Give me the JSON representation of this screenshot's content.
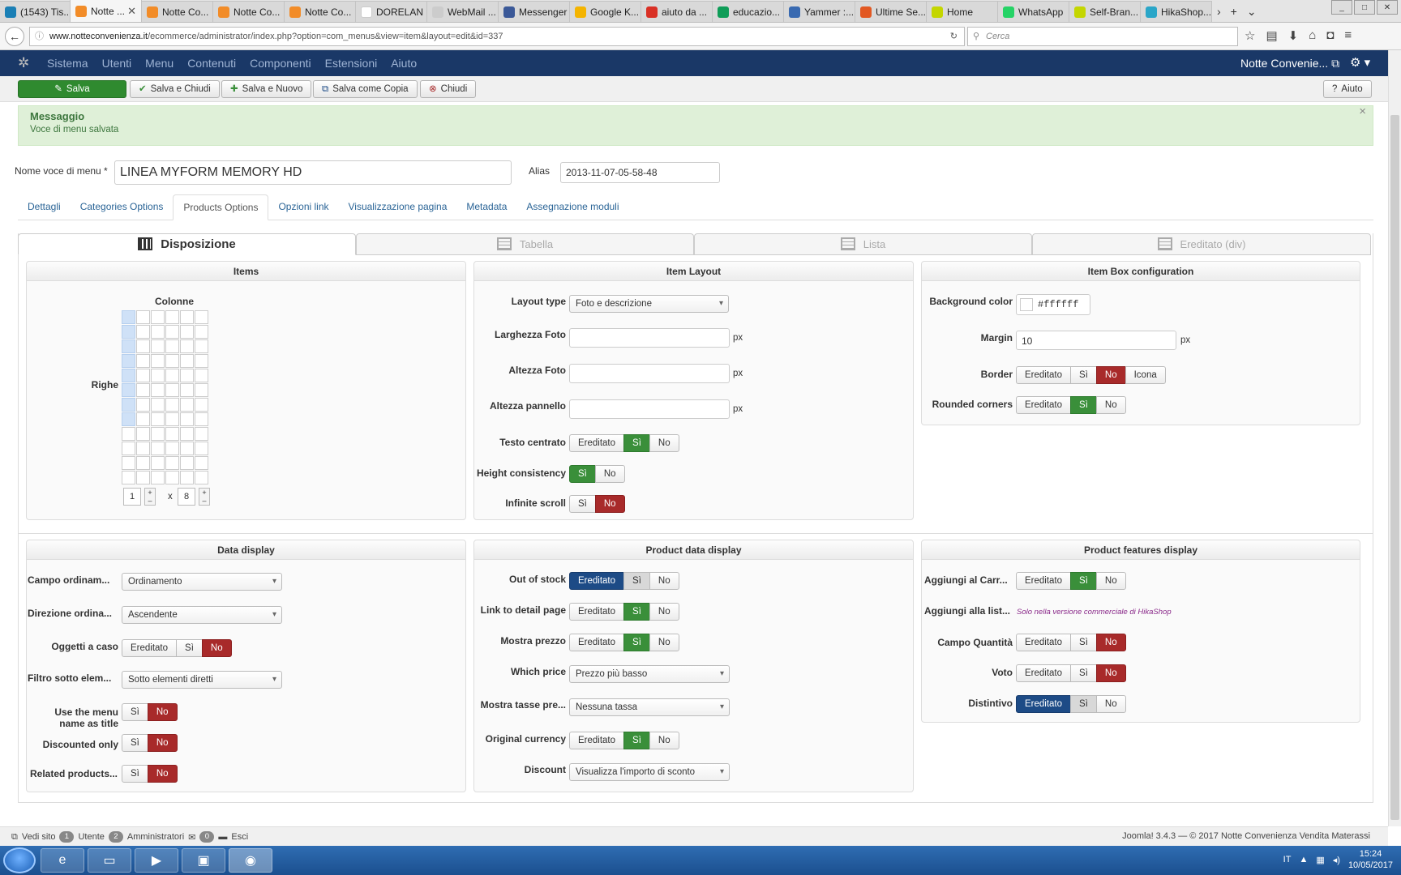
{
  "browser_tabs": [
    {
      "label": "(1543) Tis...",
      "color": "#1a7fb5"
    },
    {
      "label": "Notte ...",
      "color": "#f28c28",
      "active": true
    },
    {
      "label": "Notte Co...",
      "color": "#f28c28"
    },
    {
      "label": "Notte Co...",
      "color": "#f28c28"
    },
    {
      "label": "Notte Co...",
      "color": "#f28c28"
    },
    {
      "label": "DORELAN LI...",
      "color": "#ffffff"
    },
    {
      "label": "WebMail ...",
      "color": "#cccccc"
    },
    {
      "label": "Messenger",
      "color": "#3b5998"
    },
    {
      "label": "Google K...",
      "color": "#f4b400"
    },
    {
      "label": "aiuto da ...",
      "color": "#d93025"
    },
    {
      "label": "educazio...",
      "color": "#0f9d58"
    },
    {
      "label": "Yammer :...",
      "color": "#396ab1"
    },
    {
      "label": "Ultime Se...",
      "color": "#e25822"
    },
    {
      "label": "Home",
      "color": "#c4d600"
    },
    {
      "label": "WhatsApp",
      "color": "#25d366"
    },
    {
      "label": "Self-Bran...",
      "color": "#c4d600"
    },
    {
      "label": "HikaShop...",
      "color": "#2aa6c8"
    }
  ],
  "url": {
    "host": "www.notteconvenienza.it",
    "path": "/ecommerce/administrator/index.php?option=com_menus&view=item&layout=edit&id=337"
  },
  "search_placeholder": "Cerca",
  "admin_menu": [
    "Sistema",
    "Utenti",
    "Menu",
    "Contenuti",
    "Componenti",
    "Estensioni",
    "Aiuto"
  ],
  "site_name": "Notte Convenie...",
  "toolbar": {
    "save": "Salva",
    "save_close": "Salva e Chiudi",
    "save_new": "Salva e Nuovo",
    "save_copy": "Salva come Copia",
    "close": "Chiudi",
    "help": "Aiuto"
  },
  "message": {
    "title": "Messaggio",
    "text": "Voce di menu salvata"
  },
  "form": {
    "name_label": "Nome voce di menu *",
    "name_value": "LINEA MYFORM MEMORY HD",
    "alias_label": "Alias",
    "alias_value": "2013-11-07-05-58-48"
  },
  "page_tabs": [
    "Dettagli",
    "Categories Options",
    "Products Options",
    "Opzioni link",
    "Visualizzazione pagina",
    "Metadata",
    "Assegnazione moduli"
  ],
  "layout_tabs": [
    "Disposizione",
    "Tabella",
    "Lista",
    "Ereditato (div)"
  ],
  "items_panel": {
    "title": "Items",
    "cols_label": "Colonne",
    "rows_label": "Righe",
    "cols_value": "1",
    "x": "x",
    "rows_value": "8",
    "plus": "+",
    "minus": "–",
    "grid_columns": 6,
    "grid_rows": 12,
    "selected_columns": 1,
    "selected_rows": 8
  },
  "item_layout": {
    "title": "Item Layout",
    "layout_type_label": "Layout type",
    "layout_type_value": "Foto e descrizione",
    "width_label": "Larghezza Foto",
    "height_label": "Altezza Foto",
    "panel_height_label": "Altezza pannello",
    "unit": "px",
    "centered_label": "Testo centrato",
    "consistency_label": "Height consistency",
    "infinite_label": "Infinite scroll"
  },
  "item_box": {
    "title": "Item Box configuration",
    "bg_label": "Background color",
    "bg_value": "#ffffff",
    "margin_label": "Margin",
    "margin_value": "10",
    "unit": "px",
    "border_label": "Border",
    "rounded_label": "Rounded corners"
  },
  "data_display": {
    "title": "Data display",
    "order_label": "Campo ordinam...",
    "order_value": "Ordinamento",
    "direction_label": "Direzione ordina...",
    "direction_value": "Ascendente",
    "random_label": "Oggetti a caso",
    "filter_label": "Filtro sotto elem...",
    "filter_value": "Sotto elementi diretti",
    "menu_title_label_1": "Use the menu",
    "menu_title_label_2": "name as title",
    "discounted_label": "Discounted only",
    "related_label": "Related products..."
  },
  "product_data": {
    "title": "Product data display",
    "stock_label": "Out of stock",
    "link_label": "Link to detail page",
    "price_label": "Mostra prezzo",
    "which_label": "Which price",
    "which_value": "Prezzo più basso",
    "tax_label": "Mostra tasse pre...",
    "tax_value": "Nessuna tassa",
    "currency_label": "Original currency",
    "discount_label": "Discount",
    "discount_value": "Visualizza l'importo di sconto"
  },
  "features": {
    "title": "Product features display",
    "cart_label": "Aggiungi al Carr...",
    "wishlist_label": "Aggiungi alla list...",
    "wishlist_note": "Solo nella versione commerciale di HikaShop",
    "qty_label": "Campo Quantità",
    "vote_label": "Voto",
    "badge_label": "Distintivo"
  },
  "opt": {
    "inherited": "Ereditato",
    "yes": "Sì",
    "no": "No",
    "icon": "Icona"
  },
  "footer": {
    "view_site": "Vedi sito",
    "users_count": "1",
    "users_label": "Utente",
    "admins_count": "2",
    "admins_label": "Amministratori",
    "msg_count": "0",
    "logout": "Esci",
    "version": "Joomla! 3.4.3 — © 2017 Notte Convenienza Vendita Materassi"
  },
  "taskbar": {
    "lang": "IT",
    "time": "15:24",
    "date": "10/05/2017"
  },
  "colors": {
    "admin_bar": "#1a3867",
    "success": "#3a8f3a",
    "danger": "#a82a2a",
    "primary": "#1d4b86"
  }
}
